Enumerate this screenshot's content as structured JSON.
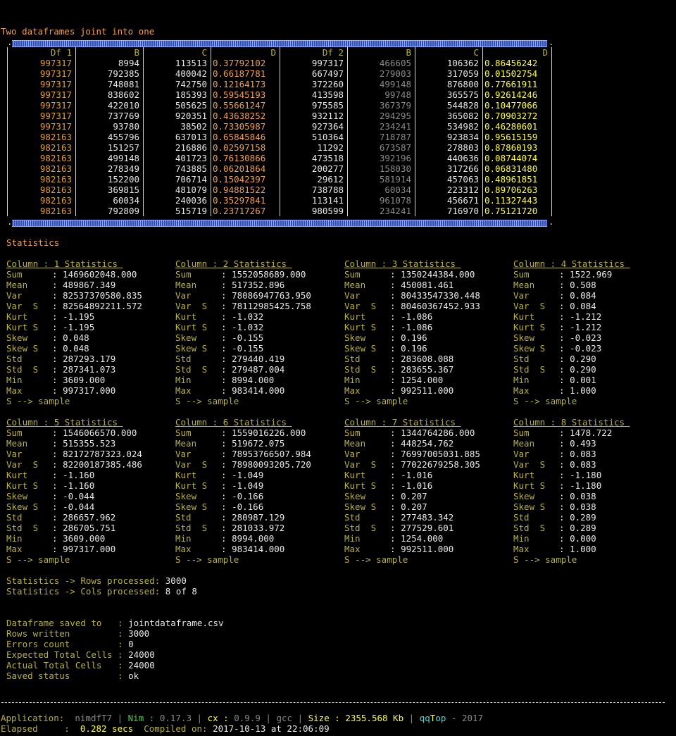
{
  "heading": "Two dataframes joint into one",
  "table": {
    "headers": [
      "Df 1",
      "B",
      "C",
      "D",
      "Df 2",
      "B",
      "C",
      "D"
    ],
    "rows": [
      [
        "997317",
        "8994",
        "113513",
        "0.37792102",
        "997317",
        "466605",
        "106362",
        "0.86456242"
      ],
      [
        "997317",
        "792385",
        "400042",
        "0.66187781",
        "667497",
        "279003",
        "317059",
        "0.01502754"
      ],
      [
        "997317",
        "748081",
        "742750",
        "0.12164173",
        "372260",
        "499148",
        "876800",
        "0.77661911"
      ],
      [
        "997317",
        "838602",
        "185393",
        "0.59545193",
        "413598",
        "99748",
        "365575",
        "0.92614246"
      ],
      [
        "997317",
        "422010",
        "505625",
        "0.55661247",
        "975585",
        "367379",
        "544828",
        "0.10477066"
      ],
      [
        "997317",
        "737769",
        "920351",
        "0.43638252",
        "932112",
        "294295",
        "365082",
        "0.70903272"
      ],
      [
        "997317",
        "93780",
        "38502",
        "0.73305987",
        "927364",
        "234241",
        "534982",
        "0.46280601"
      ],
      [
        "982163",
        "455796",
        "637013",
        "0.65845846",
        "510364",
        "718787",
        "923834",
        "0.95615159"
      ],
      [
        "982163",
        "151257",
        "216886",
        "0.02597158",
        "11292",
        "673587",
        "278803",
        "0.87860193"
      ],
      [
        "982163",
        "499148",
        "401723",
        "0.76130866",
        "473518",
        "392196",
        "440636",
        "0.08744074"
      ],
      [
        "982163",
        "278349",
        "743885",
        "0.06201864",
        "200277",
        "158030",
        "317266",
        "0.06831480"
      ],
      [
        "982163",
        "152200",
        "706714",
        "0.15042397",
        "29612",
        "581914",
        "457063",
        "0.48961851"
      ],
      [
        "982163",
        "369815",
        "481079",
        "0.94881522",
        "738788",
        "60034",
        "223312",
        "0.89706263"
      ],
      [
        "982163",
        "60034",
        "240036",
        "0.35297841",
        "113141",
        "961078",
        "456671",
        "0.11327443"
      ],
      [
        "982163",
        "792809",
        "515719",
        "0.23717267",
        "980599",
        "234241",
        "716970",
        "0.75121720"
      ]
    ]
  },
  "statistics_heading": "Statistics",
  "stat_labels": [
    "Sum",
    "Mean",
    "Var",
    "Var  S",
    "Kurt",
    "Kurt S",
    "Skew",
    "Skew S",
    "Std",
    "Std  S",
    "Min",
    "Max"
  ],
  "sample_note": "S --> sample",
  "stats": [
    {
      "title": "Column : 1 Statistics ",
      "values": [
        "1469602048.000",
        "489867.349",
        "82537370580.835",
        "82564892211.572",
        "-1.195",
        "-1.195",
        "0.048",
        "0.048",
        "287293.179",
        "287341.073",
        "3609.000",
        "997317.000"
      ]
    },
    {
      "title": "Column : 2 Statistics ",
      "values": [
        "1552058689.000",
        "517352.896",
        "78086947763.950",
        "78112985425.758",
        "-1.032",
        "-1.032",
        "-0.155",
        "-0.155",
        "279440.419",
        "279487.004",
        "8994.000",
        "983414.000"
      ]
    },
    {
      "title": "Column : 3 Statistics ",
      "values": [
        "1350244384.000",
        "450081.461",
        "80433547330.448",
        "80460367452.933",
        "-1.086",
        "-1.086",
        "0.196",
        "0.196",
        "283608.088",
        "283655.367",
        "1254.000",
        "992511.000"
      ]
    },
    {
      "title": "Column : 4 Statistics ",
      "values": [
        "1522.969",
        "0.508",
        "0.084",
        "0.084",
        "-1.212",
        "-1.212",
        "-0.023",
        "-0.023",
        "0.290",
        "0.290",
        "0.001",
        "1.000"
      ]
    },
    {
      "title": "Column : 5 Statistics ",
      "values": [
        "1546066570.000",
        "515355.523",
        "82172787323.024",
        "82200187385.486",
        "-1.160",
        "-1.160",
        "-0.044",
        "-0.044",
        "286657.962",
        "286705.751",
        "3609.000",
        "997317.000"
      ]
    },
    {
      "title": "Column : 6 Statistics ",
      "values": [
        "1559016226.000",
        "519672.075",
        "78953766507.984",
        "78980093205.720",
        "-1.049",
        "-1.049",
        "-0.166",
        "-0.166",
        "280987.129",
        "281033.972",
        "8994.000",
        "983414.000"
      ]
    },
    {
      "title": "Column : 7 Statistics ",
      "values": [
        "1344764286.000",
        "448254.762",
        "76997005031.885",
        "77022679258.305",
        "-1.016",
        "-1.016",
        "0.207",
        "0.207",
        "277483.342",
        "277529.601",
        "1254.000",
        "992511.000"
      ]
    },
    {
      "title": "Column : 8 Statistics ",
      "values": [
        "1478.722",
        "0.493",
        "0.083",
        "0.083",
        "-1.180",
        "-1.180",
        "0.038",
        "0.038",
        "0.289",
        "0.289",
        "0.000",
        "1.000"
      ]
    }
  ],
  "processed": {
    "rows_label": "Statistics -> Rows processed:",
    "rows_value": "3000",
    "cols_label": "Statistics -> Cols processed:",
    "cols_value": "8 of 8"
  },
  "save": [
    {
      "label": "Dataframe saved to   : ",
      "value": "jointdataframe.csv"
    },
    {
      "label": "Rows written         : ",
      "value": "3000"
    },
    {
      "label": "Errors count         : ",
      "value": "0"
    },
    {
      "label": "Expected Total Cells : ",
      "value": "24000"
    },
    {
      "label": "Actual Total Cells   : ",
      "value": "24000"
    },
    {
      "label": "Saved status         : ",
      "value": "ok"
    }
  ],
  "footer": {
    "app_label": "Application:",
    "app_name": "nimdfT7",
    "nim_label": "Nim :",
    "nim_version": "0.17.3",
    "cx_label": "cx :",
    "cx_version": "0.9.9",
    "compiler": "gcc",
    "size_label": "Size :",
    "size_value": "2355.568 Kb",
    "brand_qq": "qq",
    "brand_t": "T",
    "brand_op": "op",
    "year": "- 2017",
    "elapsed_label": "Elapsed     :",
    "elapsed_value": "0.282 secs",
    "compiled_label": "Compiled on:",
    "compiled_value": "2017-10-13 at 22:06:09"
  }
}
